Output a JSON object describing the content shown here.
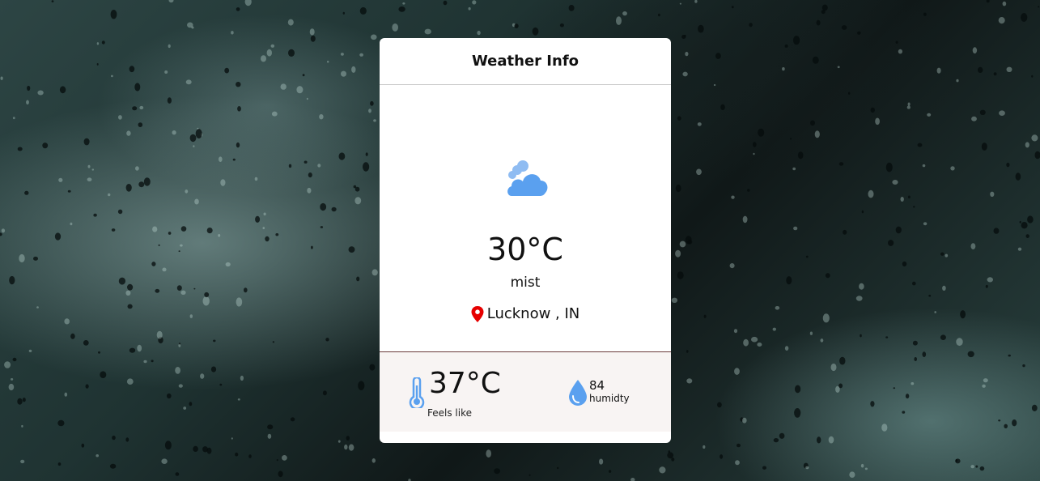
{
  "card": {
    "title": "Weather Info"
  },
  "current": {
    "icon": "cloud-icon",
    "temperature": "30°C",
    "description": "mist",
    "location": "Lucknow , IN",
    "location_icon": "map-pin-icon"
  },
  "details": {
    "feels_like_value": "37°C",
    "feels_like_label": "Feels like",
    "feels_like_icon": "thermometer-icon",
    "humidity_value": "84",
    "humidity_label": "humidty",
    "humidity_icon": "water-drop-icon"
  },
  "colors": {
    "icon_blue": "#5aa0ef",
    "pin_red": "#e60000",
    "footer_bg": "#f8f4f3"
  }
}
